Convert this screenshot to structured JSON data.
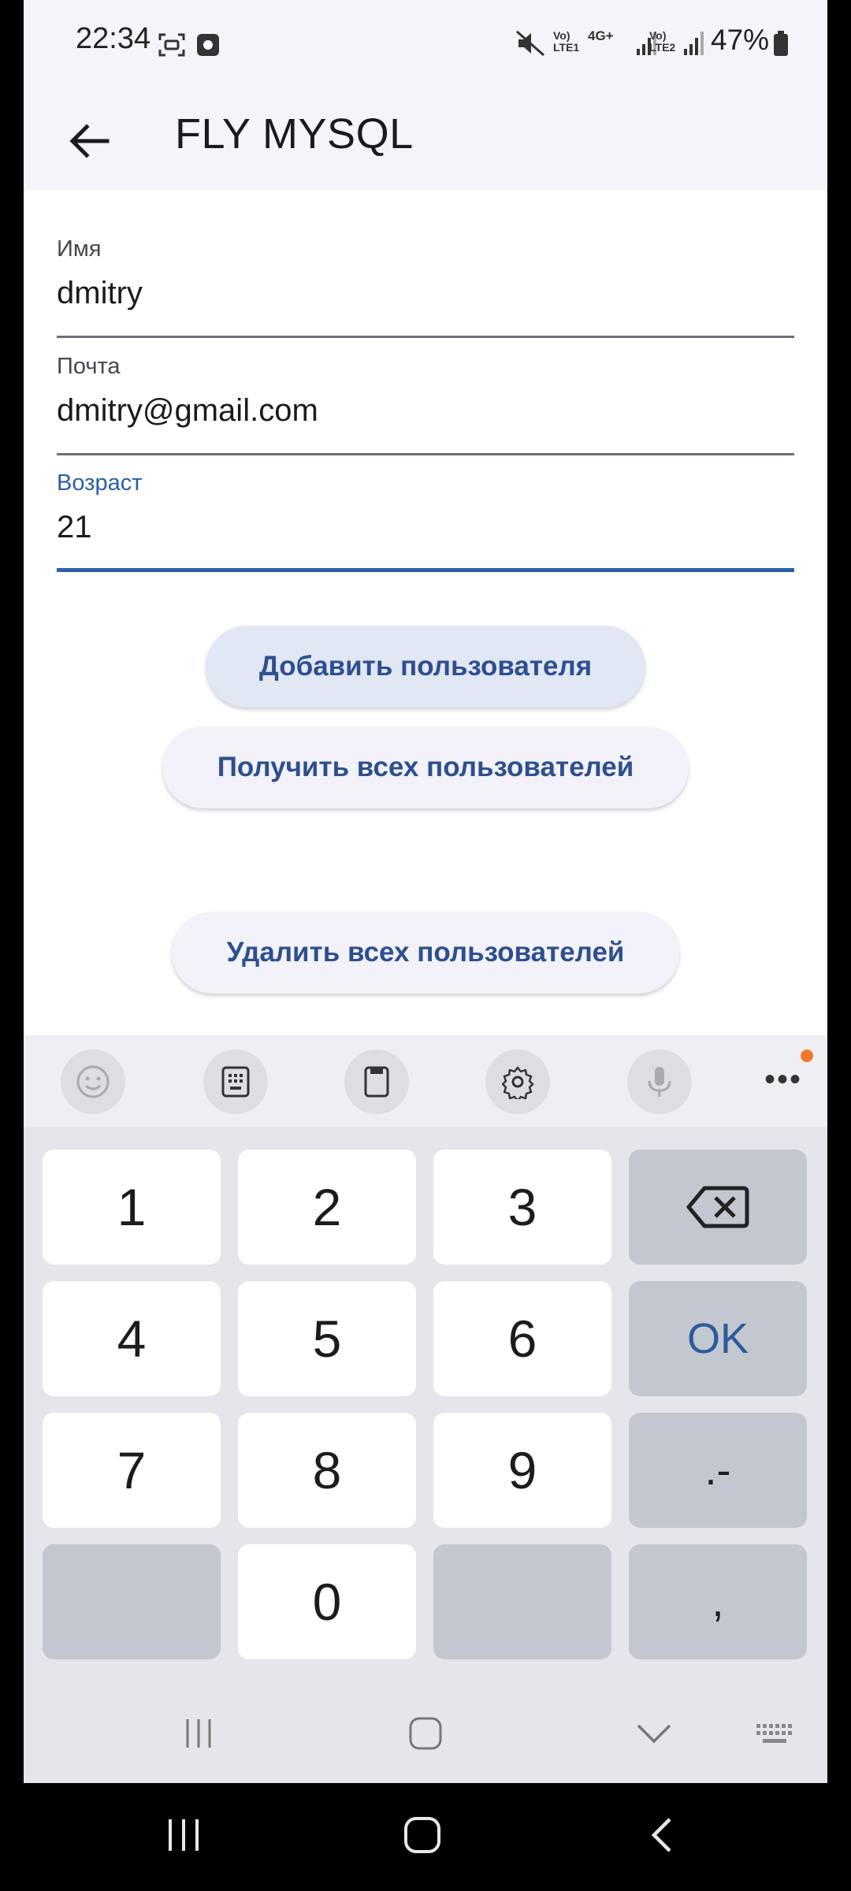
{
  "status_bar": {
    "time": "22:34",
    "battery": "47%",
    "sim1_label": "Vo) LTE1",
    "net_label": "4G+",
    "sim2_label": "Vo) LTE2"
  },
  "app_bar": {
    "title": "FLY MYSQL"
  },
  "form": {
    "name_label": "Имя",
    "name_value": "dmitry",
    "email_label": "Почта",
    "email_value": "dmitry@gmail.com",
    "age_label": "Возраст",
    "age_value": "21"
  },
  "actions": {
    "add_user": "Добавить пользователя",
    "get_all_users": "Получить всех пользователей",
    "delete_all_users": "Удалить всех пользователей"
  },
  "keyboard": {
    "toolbar_icons": [
      "emoji-icon",
      "keypad-icon",
      "clipboard-icon",
      "settings-icon",
      "mic-icon",
      "more-icon"
    ],
    "keys": {
      "k1": "1",
      "k2": "2",
      "k3": "3",
      "k4": "4",
      "k5": "5",
      "k6": "6",
      "k7": "7",
      "k8": "8",
      "k9": "9",
      "k0": "0",
      "ok": "OK",
      "dot_dash": ".-",
      "comma": ","
    }
  },
  "colors": {
    "accent": "#2a5ea8",
    "button_text": "#2e4f8f",
    "app_bar_bg": "#f5f4fb",
    "keyboard_bg": "#e4e6ec",
    "notification_dot": "#f07a2a"
  }
}
